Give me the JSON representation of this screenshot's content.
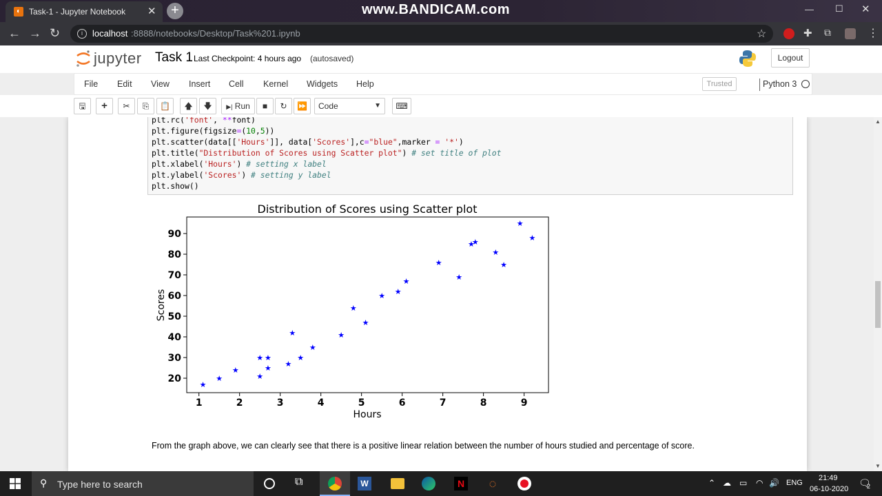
{
  "browser": {
    "tab_title": "Task-1 - Jupyter Notebook",
    "watermark": "www.BANDICAM.com",
    "url_host": "localhost",
    "url_path": ":8888/notebooks/Desktop/Task%201.ipynb"
  },
  "jupyter": {
    "logo_text": "jupyter",
    "notebook_name": "Task 1",
    "checkpoint": "Last Checkpoint: 4 hours ago",
    "autosave": "(autosaved)",
    "logout_label": "Logout",
    "menu": [
      "File",
      "Edit",
      "View",
      "Insert",
      "Cell",
      "Kernel",
      "Widgets",
      "Help"
    ],
    "trusted_label": "Trusted",
    "kernel_name": "Python 3",
    "run_label": "Run",
    "cell_type": "Code"
  },
  "code_lines": [
    "plt.rc('font', **font)",
    "plt.figure(figsize=(10,5))",
    "plt.scatter(data[['Hours']], data['Scores'],c=\"blue\",marker = '*')",
    "plt.title(\"Distribution of Scores using Scatter plot\") # set title of plot",
    "plt.xlabel('Hours') # setting x label",
    "plt.ylabel('Scores') # setting y label",
    "plt.show()"
  ],
  "chart_data": {
    "type": "scatter",
    "title": "Distribution of Scores using Scatter plot",
    "xlabel": "Hours",
    "ylabel": "Scores",
    "xlim": [
      0.7,
      9.6
    ],
    "ylim": [
      13,
      98
    ],
    "xticks": [
      1,
      2,
      3,
      4,
      5,
      6,
      7,
      8,
      9
    ],
    "yticks": [
      20,
      30,
      40,
      50,
      60,
      70,
      80,
      90
    ],
    "marker": "*",
    "color": "#0000ff",
    "grid": false,
    "points": [
      {
        "x": 1.1,
        "y": 17
      },
      {
        "x": 1.5,
        "y": 20
      },
      {
        "x": 1.9,
        "y": 24
      },
      {
        "x": 2.5,
        "y": 21
      },
      {
        "x": 2.5,
        "y": 30
      },
      {
        "x": 2.7,
        "y": 25
      },
      {
        "x": 2.7,
        "y": 30
      },
      {
        "x": 3.2,
        "y": 27
      },
      {
        "x": 3.3,
        "y": 42
      },
      {
        "x": 3.5,
        "y": 30
      },
      {
        "x": 3.8,
        "y": 35
      },
      {
        "x": 4.5,
        "y": 41
      },
      {
        "x": 4.8,
        "y": 54
      },
      {
        "x": 5.1,
        "y": 47
      },
      {
        "x": 5.5,
        "y": 60
      },
      {
        "x": 5.9,
        "y": 62
      },
      {
        "x": 6.1,
        "y": 67
      },
      {
        "x": 6.9,
        "y": 76
      },
      {
        "x": 7.4,
        "y": 69
      },
      {
        "x": 7.7,
        "y": 85
      },
      {
        "x": 7.8,
        "y": 86
      },
      {
        "x": 8.3,
        "y": 81
      },
      {
        "x": 8.5,
        "y": 75
      },
      {
        "x": 8.9,
        "y": 95
      },
      {
        "x": 9.2,
        "y": 88
      }
    ]
  },
  "conclusion": "From the graph above, we can clearly see that there is a positive linear relation between the number of hours studied and percentage of score.",
  "taskbar": {
    "search_placeholder": "Type here to search",
    "language": "ENG",
    "time": "21:49",
    "date": "06-10-2020",
    "notification_count": "2"
  }
}
